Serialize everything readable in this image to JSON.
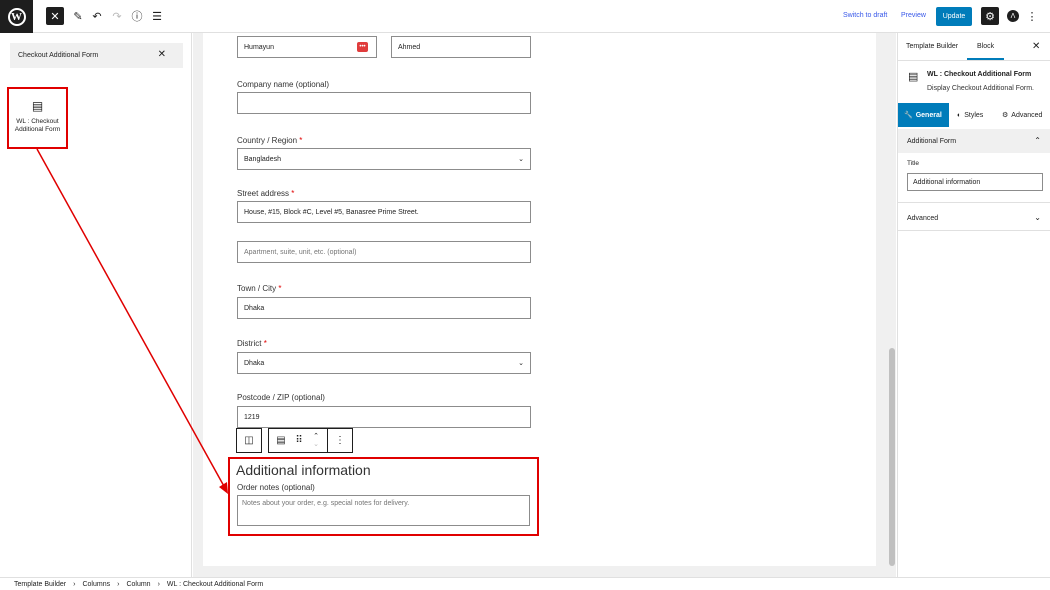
{
  "topbar": {
    "switch_to_draft": "Switch to draft",
    "preview": "Preview",
    "update": "Update",
    "colors": {
      "accent": "#007cba",
      "link": "#3858e9",
      "highlight": "#e00000"
    }
  },
  "left_panel": {
    "search_value": "Checkout Additional Form",
    "block_label": "WL : Checkout Additional Form"
  },
  "form": {
    "first_name": "Humayun",
    "last_name": "Ahmed",
    "company_label": "Company name (optional)",
    "country_label": "Country / Region",
    "country_value": "Bangladesh",
    "street_label": "Street address",
    "street_value": "House, #15, Block #C, Level #5, Banasree Prime Street.",
    "apartment_placeholder": "Apartment, suite, unit, etc. (optional)",
    "town_label": "Town / City",
    "town_value": "Dhaka",
    "district_label": "District",
    "district_value": "Dhaka",
    "postcode_label": "Postcode / ZIP (optional)",
    "postcode_value": "1219",
    "required_mark": "*"
  },
  "additional": {
    "title": "Additional information",
    "notes_label": "Order notes (optional)",
    "notes_placeholder": "Notes about your order, e.g. special notes for delivery."
  },
  "right_panel": {
    "tab_template_builder": "Template Builder",
    "tab_block": "Block",
    "block_title": "WL : Checkout Additional Form",
    "block_desc": "Display Checkout Additional Form.",
    "tab_general": "General",
    "tab_styles": "Styles",
    "tab_advanced": "Advanced",
    "section_additional_form": "Additional Form",
    "title_label": "Title",
    "title_value": "Additional information",
    "section_advanced": "Advanced"
  },
  "breadcrumb": [
    "Template Builder",
    "Columns",
    "Column",
    "WL : Checkout Additional Form"
  ]
}
